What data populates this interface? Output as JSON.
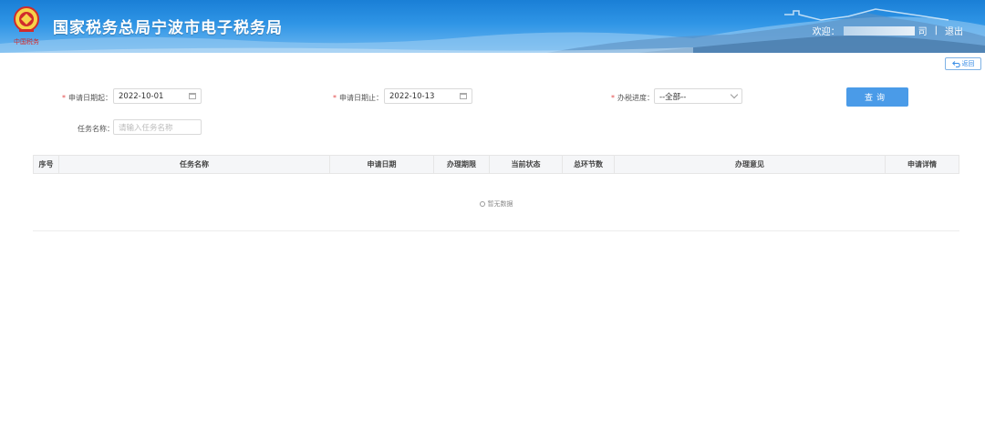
{
  "header": {
    "title": "国家税务总局宁波市电子税务局",
    "emblem_text": "中国税务",
    "welcome": "欢迎：",
    "user_suffix": "司",
    "separator": "|",
    "logout": "退出"
  },
  "back_button": {
    "label": "返回"
  },
  "form": {
    "start_date_label": "申请日期起：",
    "start_date_value": "2022-10-01",
    "end_date_label": "申请日期止：",
    "end_date_value": "2022-10-13",
    "progress_label": "办税进度：",
    "progress_value": "--全部--",
    "task_name_label": "任务名称：",
    "task_name_placeholder": "请输入任务名称",
    "required_mark": "*",
    "query_button": "查询"
  },
  "table": {
    "columns": [
      "序号",
      "任务名称",
      "申请日期",
      "办理期限",
      "当前状态",
      "总环节数",
      "办理意见",
      "申请详情"
    ],
    "empty_text": "暂无数据"
  },
  "colors": {
    "header_blue": "#1a7fd6",
    "primary_button": "#4a9be8",
    "required": "#e34b4b"
  }
}
